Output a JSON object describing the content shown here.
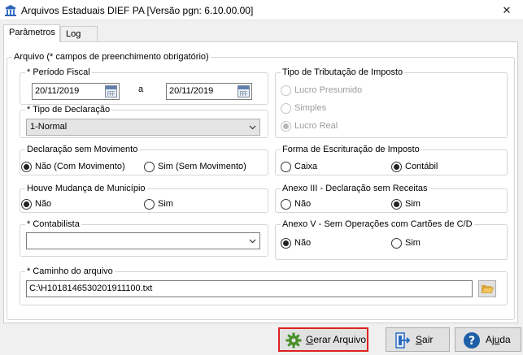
{
  "window": {
    "title": "Arquivos Estaduais DIEF PA [Versão pgn: 6.10.00.00]",
    "close_glyph": "✕"
  },
  "tabs": [
    {
      "label": "Parâmetros",
      "active": true
    },
    {
      "label": "Log",
      "active": false
    }
  ],
  "arquivo_group": {
    "legend": "Arquivo (* campos de preenchimento obrigatório)"
  },
  "periodo_fiscal": {
    "legend": "* Período Fiscal",
    "start": "20/11/2019",
    "separator": "a",
    "end": "20/11/2019"
  },
  "tipo_declaracao": {
    "legend": "* Tipo de Declaração",
    "value": "1-Normal"
  },
  "tipo_tributacao": {
    "legend": "Tipo de Tributação de Imposto",
    "options": [
      "Lucro Presumido",
      "Simples",
      "Lucro Real"
    ],
    "selected": "Lucro Real",
    "disabled": true
  },
  "declaracao_sem_movimento": {
    "legend": "Declaração sem Movimento",
    "options": [
      "Não (Com Movimento)",
      "Sim (Sem Movimento)"
    ],
    "selected": "Não (Com Movimento)"
  },
  "forma_escrituracao": {
    "legend": "Forma de Escrituração de Imposto",
    "options": [
      "Caixa",
      "Contábil"
    ],
    "selected": "Contábil"
  },
  "mudanca_municipio": {
    "legend": "Houve Mudança de Município",
    "options": [
      "Não",
      "Sim"
    ],
    "selected": "Não"
  },
  "anexo_iii": {
    "legend": "Anexo III - Declaração sem Receitas",
    "options": [
      "Não",
      "Sim"
    ],
    "selected": "Sim"
  },
  "contabilista": {
    "legend": "* Contabilista",
    "value": ""
  },
  "anexo_v": {
    "legend": "Anexo V - Sem Operações com Cartões de C/D",
    "options": [
      "Não",
      "Sim"
    ],
    "selected": "Não"
  },
  "caminho_arquivo": {
    "legend": "* Caminho do arquivo",
    "value": "C:\\H1018146530201911100.txt"
  },
  "buttons": {
    "gerar": {
      "mnemonic": "G",
      "rest": "erar Arquivo",
      "highlighted": true
    },
    "sair": {
      "mnemonic": "S",
      "rest": "air"
    },
    "ajuda": {
      "pre": "Aj",
      "mnemonic": "u",
      "rest": "da"
    }
  },
  "colors": {
    "highlight_border": "#e02020",
    "help_icon": "#1f5fa8",
    "exit_icon": "#2a6bc2"
  }
}
